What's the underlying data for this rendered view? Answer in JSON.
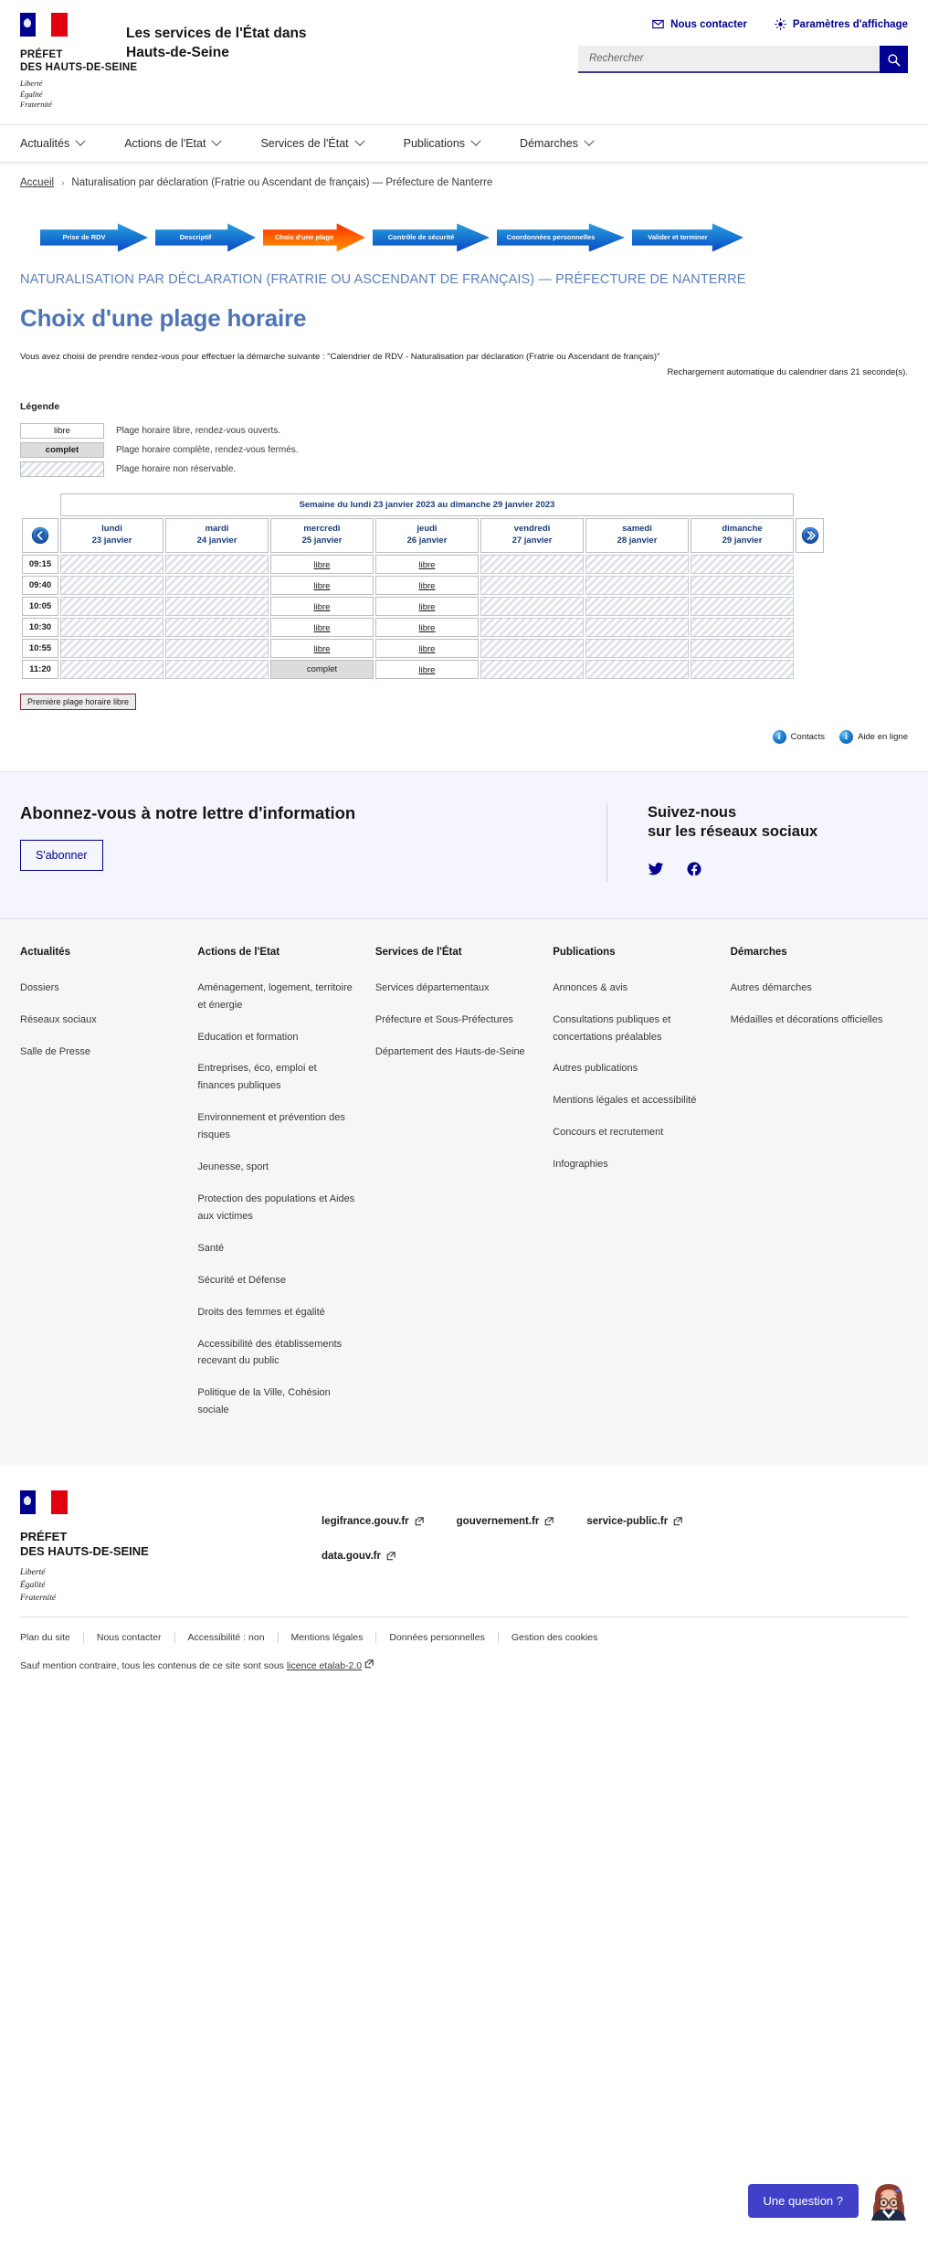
{
  "header": {
    "marianne_title": "PRÉFET\nDES HAUTS-DE-SEINE",
    "marianne_line1": "PRÉFET",
    "marianne_line2": "DES HAUTS-DE-SEINE",
    "devise_1": "Liberté",
    "devise_2": "Égalité",
    "devise_3": "Fraternité",
    "site_title": "Les services de l'État dans Hauts-de-Seine",
    "contact_label": "Nous contacter",
    "display_settings_label": "Paramètres d'affichage",
    "search_placeholder": "Rechercher",
    "search_value": ""
  },
  "nav": {
    "items": [
      {
        "label": "Actualités"
      },
      {
        "label": "Actions de l'Etat"
      },
      {
        "label": "Services de l'État"
      },
      {
        "label": "Publications"
      },
      {
        "label": "Démarches"
      }
    ]
  },
  "breadcrumb": {
    "home": "Accueil",
    "separator": "›",
    "current": "Naturalisation par déclaration (Fratrie ou Ascendant de français) — Préfecture de Nanterre"
  },
  "stepper": {
    "steps": [
      {
        "label": "Prise de RDV",
        "state": "done"
      },
      {
        "label": "Descriptif",
        "state": "done"
      },
      {
        "label": "Choix d'une plage",
        "state": "active"
      },
      {
        "label": "Contrôle de sécurité",
        "state": "todo"
      },
      {
        "label": "Coordonnées personnelles",
        "state": "todo"
      },
      {
        "label": "Valider et terminer",
        "state": "todo"
      }
    ],
    "active_color": "#ff6a00",
    "inactive_color": "#1b7fd4"
  },
  "page": {
    "kicker": "NATURALISATION PAR DÉCLARATION (FRATRIE OU ASCENDANT DE FRANÇAIS) — PRÉFECTURE DE NANTERRE",
    "title": "Choix d'une plage horaire",
    "intro": "Vous avez choisi de prendre rendez-vous pour effectuer la démarche suivante : \"Calendrier de RDV - Naturalisation par déclaration (Fratrie ou Ascendant de français)\"",
    "reload_notice": "Rechargement automatique du calendrier dans 21   seconde(s).",
    "reload_seconds": "21"
  },
  "legend": {
    "title": "Légende",
    "rows": [
      {
        "box": "libre",
        "text": "Plage horaire libre, rendez-vous ouverts."
      },
      {
        "box": "complet",
        "text": "Plage horaire complète, rendez-vous fermés."
      },
      {
        "box": "",
        "text": "Plage horaire non réservable."
      }
    ]
  },
  "calendar": {
    "week_label": "Semaine du lundi 23 janvier 2023 au dimanche 29 janvier 2023",
    "prev_label": "Semaine précédente",
    "next_label": "Semaine suivante",
    "days": [
      {
        "name": "lundi",
        "date": "23 janvier"
      },
      {
        "name": "mardi",
        "date": "24 janvier"
      },
      {
        "name": "mercredi",
        "date": "25 janvier"
      },
      {
        "name": "jeudi",
        "date": "26 janvier"
      },
      {
        "name": "vendredi",
        "date": "27 janvier"
      },
      {
        "name": "samedi",
        "date": "28 janvier"
      },
      {
        "name": "dimanche",
        "date": "29 janvier"
      }
    ],
    "times": [
      "09:15",
      "09:40",
      "10:05",
      "10:30",
      "10:55",
      "11:20"
    ],
    "slot_labels": {
      "free": "libre",
      "full": "complet",
      "na": ""
    },
    "slots": [
      [
        "na",
        "na",
        "free",
        "free",
        "na",
        "na",
        "na"
      ],
      [
        "na",
        "na",
        "free",
        "free",
        "na",
        "na",
        "na"
      ],
      [
        "na",
        "na",
        "free",
        "free",
        "na",
        "na",
        "na"
      ],
      [
        "na",
        "na",
        "free",
        "free",
        "na",
        "na",
        "na"
      ],
      [
        "na",
        "na",
        "free",
        "free",
        "na",
        "na",
        "na"
      ],
      [
        "na",
        "na",
        "full",
        "free",
        "na",
        "na",
        "na"
      ]
    ],
    "first_free_button": "Première plage horaire libre",
    "help": [
      {
        "label": "Contacts"
      },
      {
        "label": "Aide en ligne"
      }
    ]
  },
  "newsletter": {
    "title": "Abonnez-vous à notre lettre d'information",
    "button": "S'abonner",
    "follow_line1": "Suivez-nous",
    "follow_line2": "sur les réseaux sociaux",
    "socials": [
      {
        "name": "twitter"
      },
      {
        "name": "facebook"
      }
    ]
  },
  "footer_nav": {
    "columns": [
      {
        "title": "Actualités",
        "links": [
          "Dossiers",
          "Réseaux sociaux",
          "Salle de Presse"
        ]
      },
      {
        "title": "Actions de l'Etat",
        "links": [
          "Aménagement, logement, territoire et énergie",
          "Education et formation",
          "Entreprises, éco, emploi et finances publiques",
          "Environnement et prévention des risques",
          "Jeunesse, sport",
          "Protection des populations et Aides aux victimes",
          "Santé",
          "Sécurité et Défense",
          "Droits des femmes et égalité",
          "Accessibilité des établissements recevant du public",
          "Politique de la Ville, Cohésion sociale"
        ]
      },
      {
        "title": "Services de l'État",
        "links": [
          "Services départementaux",
          "Préfecture et Sous-Préfectures",
          "Département des Hauts-de-Seine"
        ]
      },
      {
        "title": "Publications",
        "links": [
          "Annonces & avis",
          "Consultations publiques et concertations préalables",
          "Autres publications",
          "Mentions légales et accessibilité",
          "Concours et recrutement",
          "Infographies"
        ]
      },
      {
        "title": "Démarches",
        "links": [
          "Autres démarches",
          "Médailles et décorations officielles"
        ]
      }
    ]
  },
  "footer_bottom": {
    "logo_line1": "PRÉFET",
    "logo_line2": "DES HAUTS-DE-SEINE",
    "devise_1": "Liberté",
    "devise_2": "Égalité",
    "devise_3": "Fraternité",
    "external_links_row1": [
      "legifrance.gouv.fr",
      "gouvernement.fr",
      "service-public.fr"
    ],
    "external_links_row2": [
      "data.gouv.fr"
    ],
    "meta_links": [
      "Plan du site",
      "Nous contacter",
      "Accessibilité : non",
      "Mentions légales",
      "Données personnelles",
      "Gestion des cookies"
    ],
    "note_prefix": "Sauf mention contraire, tous les contenus de ce site sont sous ",
    "note_link": "licence etalab-2.0"
  },
  "chat": {
    "button_label": "Une question ?",
    "button_color": "#4040c8"
  }
}
